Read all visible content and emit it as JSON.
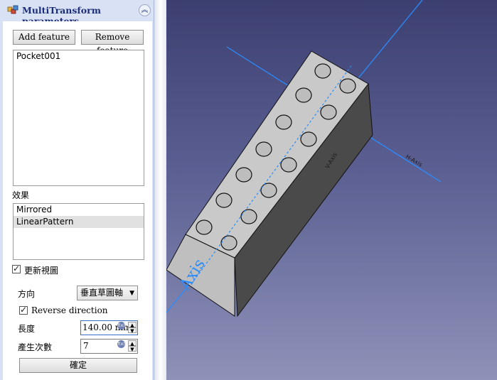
{
  "panel": {
    "title": "MultiTransform parameters",
    "add_feature": "Add feature",
    "remove_feature": "Remove feature",
    "features": [
      "Pocket001"
    ],
    "effects_label": "效果",
    "transformations": [
      {
        "label": "Mirrored",
        "selected": false
      },
      {
        "label": "LinearPattern",
        "selected": true
      }
    ],
    "update_view_label": "更新視圖",
    "update_view_checked": true,
    "direction_label": "方向",
    "direction_value": "垂直草圖軸",
    "reverse_label": "Reverse direction",
    "reverse_checked": true,
    "length_label": "長度",
    "length_value": "140.00 mm",
    "occurrences_label": "產生次數",
    "occurrences_value": "7",
    "ok_label": "確定"
  },
  "viewport": {
    "axis_label": "Axis",
    "axis_label_small": "V-Axis",
    "axis_label_right": "H-Axis",
    "background_top": "#3c3f70",
    "background_bottom": "#8e92b8",
    "axis_color": "#2a8cff"
  },
  "icons": {
    "panel_icon": "multitransform-icon",
    "collapse": "collapse-up-icon"
  }
}
